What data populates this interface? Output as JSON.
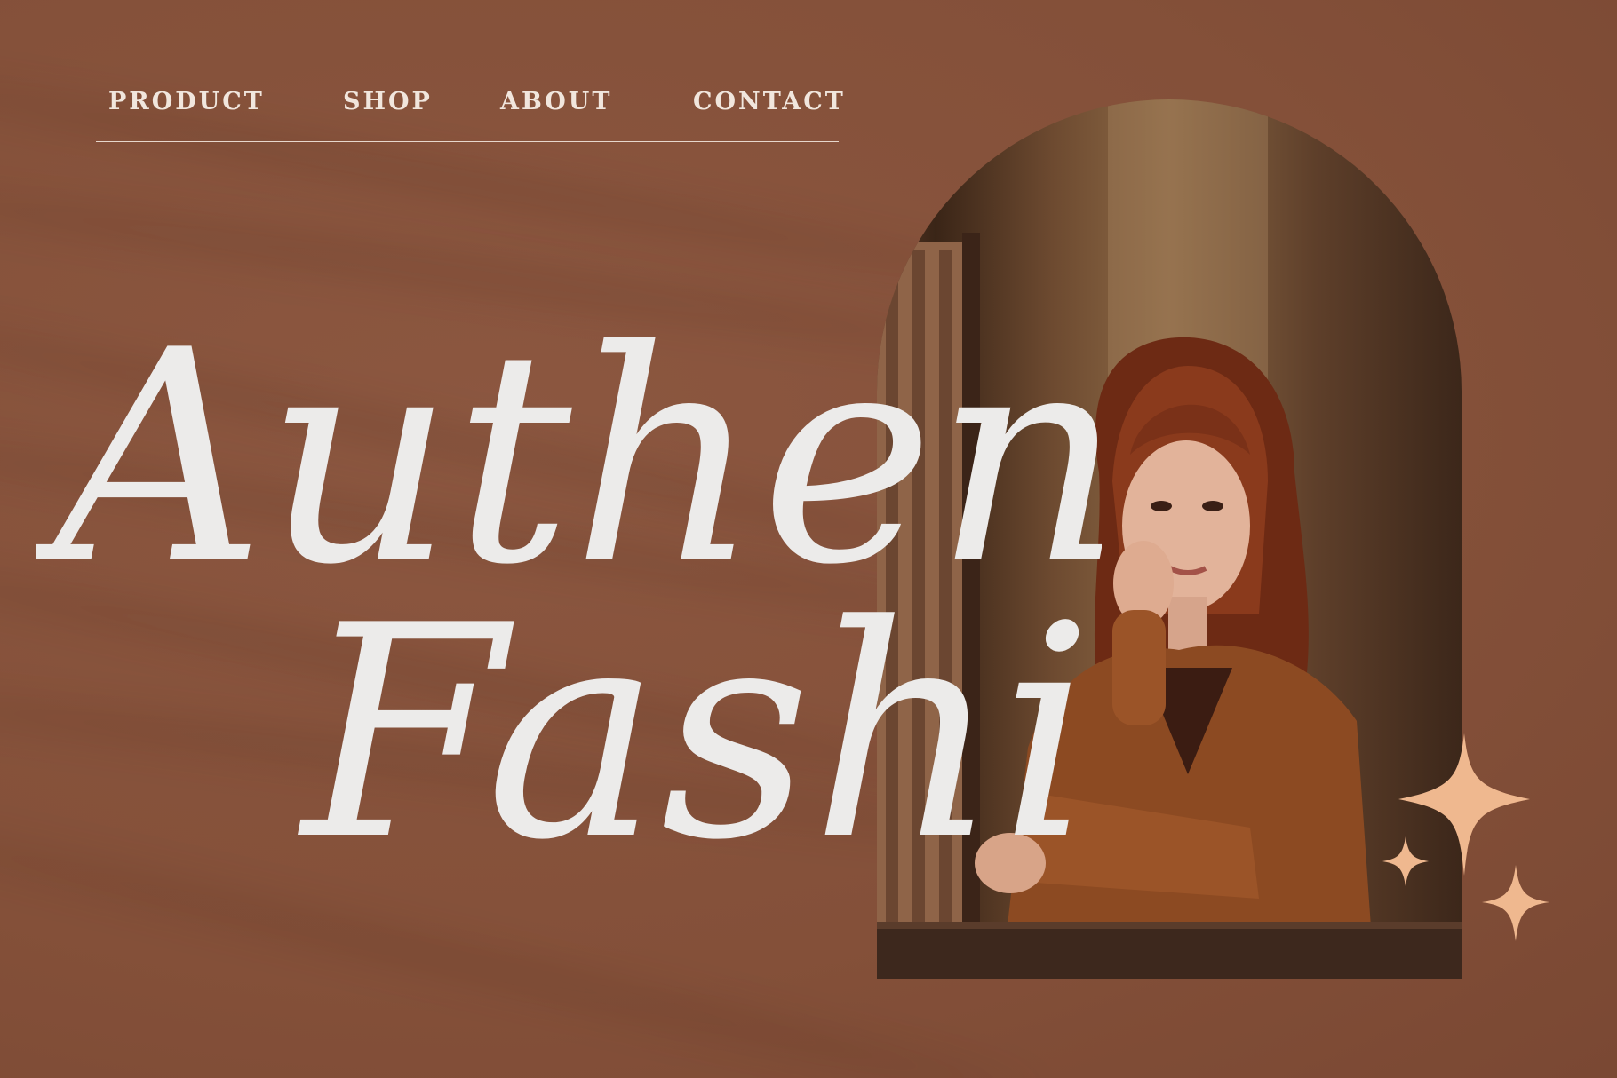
{
  "nav": {
    "items": [
      "PRODUCT",
      "SHOP",
      "ABOUT",
      "CONTACT"
    ]
  },
  "hero": {
    "line1": "Authentic",
    "line2": "Fashion"
  },
  "icons": [
    "sparkle-icon",
    "sparkle-icon",
    "sparkle-icon"
  ],
  "colors": {
    "background": "#87533c",
    "headline": "#ecebea",
    "nav_text": "#f1e6dd",
    "sparkle": "#efb88f"
  }
}
